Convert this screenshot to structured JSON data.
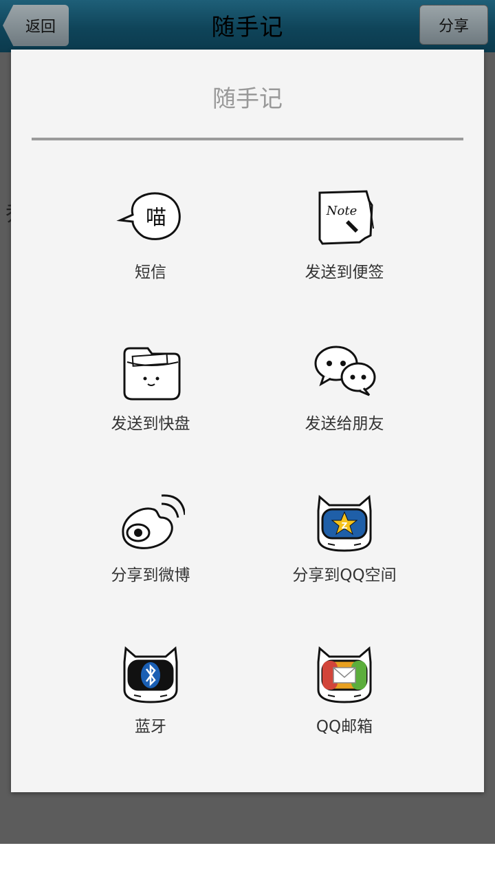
{
  "header": {
    "back_label": "返回",
    "title": "随手记",
    "share_label": "分享"
  },
  "background": {
    "partial_text": "乔"
  },
  "dialog": {
    "title": "随手记",
    "options": [
      {
        "label": "短信",
        "icon": "speech-bubble-icon"
      },
      {
        "label": "发送到便签",
        "icon": "note-icon"
      },
      {
        "label": "发送到快盘",
        "icon": "folder-icon"
      },
      {
        "label": "发送给朋友",
        "icon": "chat-bubbles-icon"
      },
      {
        "label": "分享到微博",
        "icon": "weibo-icon"
      },
      {
        "label": "分享到QQ空间",
        "icon": "qzone-icon"
      },
      {
        "label": "蓝牙",
        "icon": "bluetooth-icon"
      },
      {
        "label": "QQ邮箱",
        "icon": "qq-mail-icon"
      }
    ]
  }
}
